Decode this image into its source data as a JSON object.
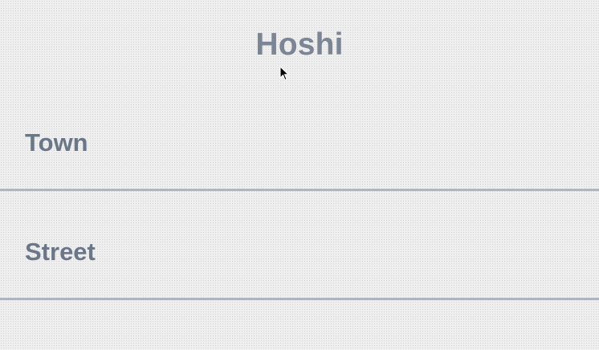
{
  "header": {
    "title": "Hoshi"
  },
  "form": {
    "fields": [
      {
        "label": "Town",
        "value": ""
      },
      {
        "label": "Street",
        "value": ""
      }
    ]
  },
  "colors": {
    "background": "#efefef",
    "title": "#7c8595",
    "label": "#6b7788",
    "underline": "#a9b5c9"
  },
  "icons": {
    "cursor": "mouse-pointer-icon"
  }
}
